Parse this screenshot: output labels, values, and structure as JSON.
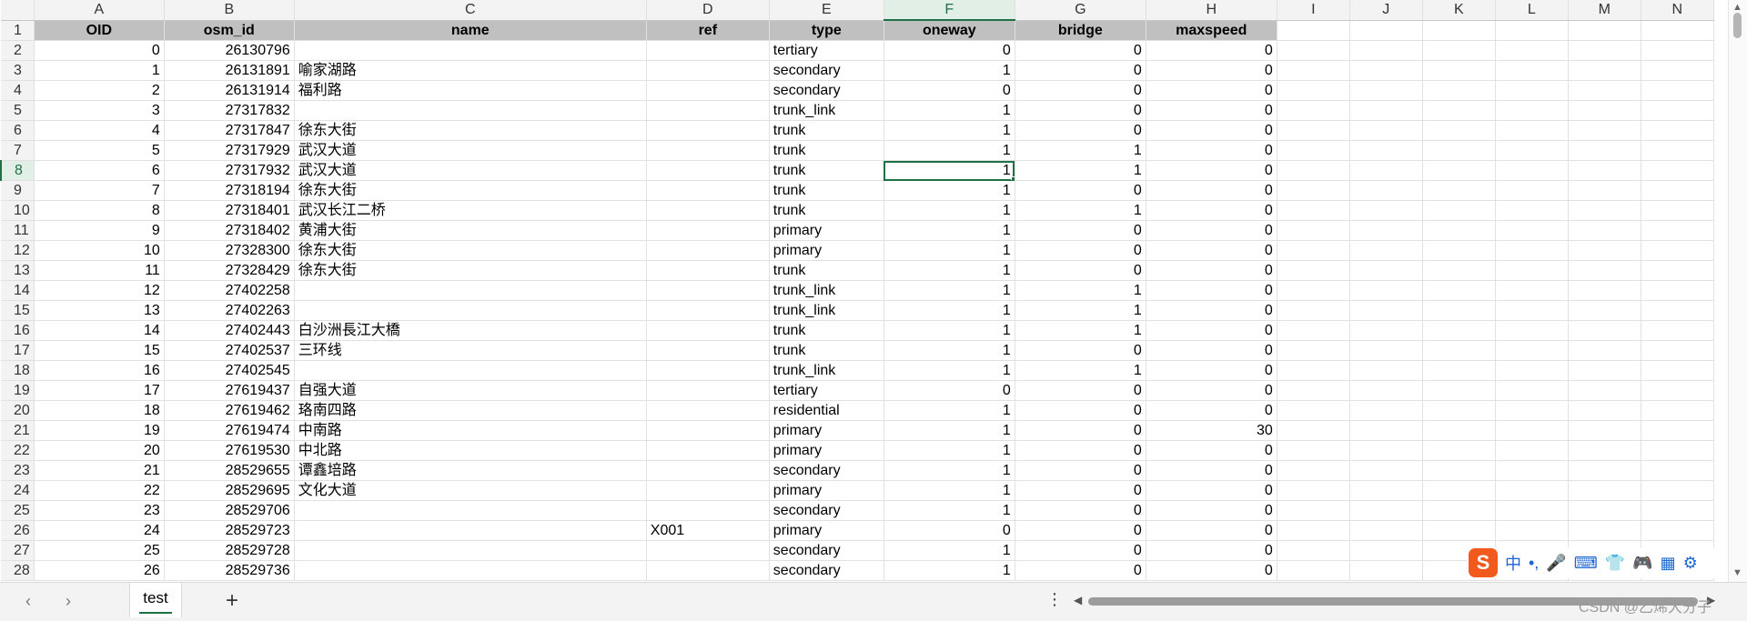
{
  "columns": [
    "A",
    "B",
    "C",
    "D",
    "E",
    "F",
    "G",
    "H",
    "I",
    "J",
    "K",
    "L",
    "M",
    "N"
  ],
  "active_column": "F",
  "active_row": "8",
  "headers": [
    "OID",
    "osm_id",
    "name",
    "ref",
    "type",
    "oneway",
    "bridge",
    "maxspeed"
  ],
  "rows": [
    {
      "r": "2",
      "oid": "0",
      "osm_id": "26130796",
      "name": "",
      "ref": "",
      "type": "tertiary",
      "oneway": "0",
      "bridge": "0",
      "maxspeed": "0"
    },
    {
      "r": "3",
      "oid": "1",
      "osm_id": "26131891",
      "name": "喻家湖路",
      "ref": "",
      "type": "secondary",
      "oneway": "1",
      "bridge": "0",
      "maxspeed": "0"
    },
    {
      "r": "4",
      "oid": "2",
      "osm_id": "26131914",
      "name": "福利路",
      "ref": "",
      "type": "secondary",
      "oneway": "0",
      "bridge": "0",
      "maxspeed": "0"
    },
    {
      "r": "5",
      "oid": "3",
      "osm_id": "27317832",
      "name": "",
      "ref": "",
      "type": "trunk_link",
      "oneway": "1",
      "bridge": "0",
      "maxspeed": "0"
    },
    {
      "r": "6",
      "oid": "4",
      "osm_id": "27317847",
      "name": "徐东大街",
      "ref": "",
      "type": "trunk",
      "oneway": "1",
      "bridge": "0",
      "maxspeed": "0"
    },
    {
      "r": "7",
      "oid": "5",
      "osm_id": "27317929",
      "name": "武汉大道",
      "ref": "",
      "type": "trunk",
      "oneway": "1",
      "bridge": "1",
      "maxspeed": "0"
    },
    {
      "r": "8",
      "oid": "6",
      "osm_id": "27317932",
      "name": "武汉大道",
      "ref": "",
      "type": "trunk",
      "oneway": "1",
      "bridge": "1",
      "maxspeed": "0"
    },
    {
      "r": "9",
      "oid": "7",
      "osm_id": "27318194",
      "name": "徐东大街",
      "ref": "",
      "type": "trunk",
      "oneway": "1",
      "bridge": "0",
      "maxspeed": "0"
    },
    {
      "r": "10",
      "oid": "8",
      "osm_id": "27318401",
      "name": "武汉长江二桥",
      "ref": "",
      "type": "trunk",
      "oneway": "1",
      "bridge": "1",
      "maxspeed": "0"
    },
    {
      "r": "11",
      "oid": "9",
      "osm_id": "27318402",
      "name": "黄浦大街",
      "ref": "",
      "type": "primary",
      "oneway": "1",
      "bridge": "0",
      "maxspeed": "0"
    },
    {
      "r": "12",
      "oid": "10",
      "osm_id": "27328300",
      "name": "徐东大街",
      "ref": "",
      "type": "primary",
      "oneway": "1",
      "bridge": "0",
      "maxspeed": "0"
    },
    {
      "r": "13",
      "oid": "11",
      "osm_id": "27328429",
      "name": "徐东大街",
      "ref": "",
      "type": "trunk",
      "oneway": "1",
      "bridge": "0",
      "maxspeed": "0"
    },
    {
      "r": "14",
      "oid": "12",
      "osm_id": "27402258",
      "name": "",
      "ref": "",
      "type": "trunk_link",
      "oneway": "1",
      "bridge": "1",
      "maxspeed": "0"
    },
    {
      "r": "15",
      "oid": "13",
      "osm_id": "27402263",
      "name": "",
      "ref": "",
      "type": "trunk_link",
      "oneway": "1",
      "bridge": "1",
      "maxspeed": "0"
    },
    {
      "r": "16",
      "oid": "14",
      "osm_id": "27402443",
      "name": "白沙洲長江大橋",
      "ref": "",
      "type": "trunk",
      "oneway": "1",
      "bridge": "1",
      "maxspeed": "0"
    },
    {
      "r": "17",
      "oid": "15",
      "osm_id": "27402537",
      "name": "三环线",
      "ref": "",
      "type": "trunk",
      "oneway": "1",
      "bridge": "0",
      "maxspeed": "0"
    },
    {
      "r": "18",
      "oid": "16",
      "osm_id": "27402545",
      "name": "",
      "ref": "",
      "type": "trunk_link",
      "oneway": "1",
      "bridge": "1",
      "maxspeed": "0"
    },
    {
      "r": "19",
      "oid": "17",
      "osm_id": "27619437",
      "name": "自强大道",
      "ref": "",
      "type": "tertiary",
      "oneway": "0",
      "bridge": "0",
      "maxspeed": "0"
    },
    {
      "r": "20",
      "oid": "18",
      "osm_id": "27619462",
      "name": "珞南四路",
      "ref": "",
      "type": "residential",
      "oneway": "1",
      "bridge": "0",
      "maxspeed": "0"
    },
    {
      "r": "21",
      "oid": "19",
      "osm_id": "27619474",
      "name": "中南路",
      "ref": "",
      "type": "primary",
      "oneway": "1",
      "bridge": "0",
      "maxspeed": "30"
    },
    {
      "r": "22",
      "oid": "20",
      "osm_id": "27619530",
      "name": "中北路",
      "ref": "",
      "type": "primary",
      "oneway": "1",
      "bridge": "0",
      "maxspeed": "0"
    },
    {
      "r": "23",
      "oid": "21",
      "osm_id": "28529655",
      "name": "谭鑫培路",
      "ref": "",
      "type": "secondary",
      "oneway": "1",
      "bridge": "0",
      "maxspeed": "0"
    },
    {
      "r": "24",
      "oid": "22",
      "osm_id": "28529695",
      "name": "文化大道",
      "ref": "",
      "type": "primary",
      "oneway": "1",
      "bridge": "0",
      "maxspeed": "0"
    },
    {
      "r": "25",
      "oid": "23",
      "osm_id": "28529706",
      "name": "",
      "ref": "",
      "type": "secondary",
      "oneway": "1",
      "bridge": "0",
      "maxspeed": "0"
    },
    {
      "r": "26",
      "oid": "24",
      "osm_id": "28529723",
      "name": "",
      "ref": "X001",
      "type": "primary",
      "oneway": "0",
      "bridge": "0",
      "maxspeed": "0"
    },
    {
      "r": "27",
      "oid": "25",
      "osm_id": "28529728",
      "name": "",
      "ref": "",
      "type": "secondary",
      "oneway": "1",
      "bridge": "0",
      "maxspeed": "0"
    },
    {
      "r": "28",
      "oid": "26",
      "osm_id": "28529736",
      "name": "",
      "ref": "",
      "type": "secondary",
      "oneway": "1",
      "bridge": "0",
      "maxspeed": "0"
    }
  ],
  "sheet_tab": "test",
  "add_sheet": "+",
  "more_menu": "⋮",
  "watermark": "CSDN @乙烯大分子",
  "ime": {
    "logo": "S",
    "items": [
      "中",
      "•,",
      "🎤",
      "⌨",
      "👕",
      "🎮",
      "▦",
      "⚙"
    ]
  },
  "colors": {
    "accent": "#1e7145",
    "header_fill": "#c0c0c0",
    "ime_logo": "#f25a1d"
  }
}
